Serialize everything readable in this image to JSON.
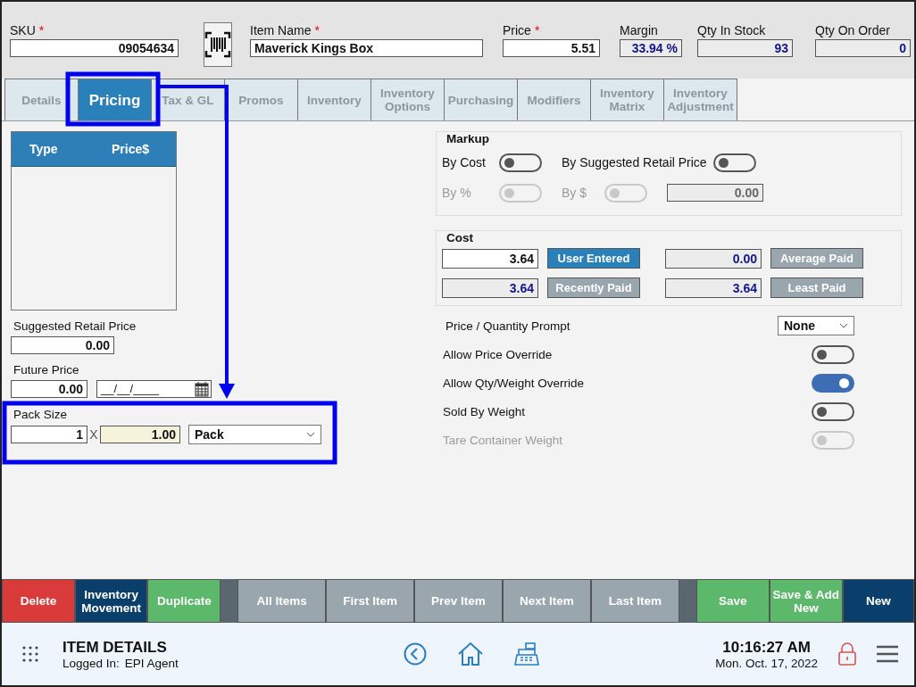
{
  "header": {
    "fields": [
      {
        "kind": "sku",
        "label": "SKU",
        "required_mark": "*",
        "value": "09054634",
        "readonly": false
      },
      {
        "kind": "name",
        "label": "Item Name",
        "required_mark": "*",
        "value": "Maverick Kings Box",
        "readonly": false
      },
      {
        "kind": "price",
        "label": "Price",
        "required_mark": "*",
        "value": "5.51",
        "readonly": false
      },
      {
        "kind": "margin",
        "label": "Margin",
        "value": "33.94 %",
        "readonly": true
      },
      {
        "kind": "stock",
        "label": "Qty In Stock",
        "value": "93",
        "readonly": true
      },
      {
        "kind": "order",
        "label": "Qty On Order",
        "value": "0",
        "readonly": true
      }
    ]
  },
  "tabs": [
    {
      "label": "Details",
      "selected": false
    },
    {
      "label": "Pricing",
      "selected": true
    },
    {
      "label": "Tax & GL",
      "selected": false
    },
    {
      "label": "Promos",
      "selected": false
    },
    {
      "label": "Inventory",
      "selected": false
    },
    {
      "label": "Inventory Options",
      "selected": false
    },
    {
      "label": "Purchasing",
      "selected": false
    },
    {
      "label": "Modifiers",
      "selected": false
    },
    {
      "label": "Inventory Matrix",
      "selected": false
    },
    {
      "label": "Inventory Adjustment",
      "selected": false
    }
  ],
  "price_table": {
    "columns": [
      "Type",
      "Price$"
    ]
  },
  "suggested_retail_price": {
    "label": "Suggested Retail Price",
    "value": "0.00"
  },
  "future_price": {
    "label": "Future Price",
    "value": "0.00",
    "date": "__/__/____"
  },
  "pack_size": {
    "label": "Pack Size",
    "quantity": "1",
    "separator": "X",
    "units": "1.00",
    "unit_type": "Pack"
  },
  "markup": {
    "title": "Markup",
    "toggles": [
      {
        "label": "By Cost",
        "on": false,
        "disabled": false
      },
      {
        "label": "By Suggested Retail Price",
        "on": false,
        "disabled": false
      },
      {
        "label": "By %",
        "on": false,
        "disabled": true
      },
      {
        "label": "By $",
        "on": false,
        "disabled": true
      }
    ],
    "amount": "0.00"
  },
  "cost": {
    "title": "Cost",
    "options": [
      {
        "value": "3.64",
        "label": "User Entered",
        "selected": true,
        "readonly": false
      },
      {
        "value": "0.00",
        "label": "Average Paid",
        "selected": false,
        "readonly": true
      },
      {
        "value": "3.64",
        "label": "Recently Paid",
        "selected": false,
        "readonly": true
      },
      {
        "value": "3.64",
        "label": "Least Paid",
        "selected": false,
        "readonly": true
      }
    ]
  },
  "prompt": {
    "label": "Price / Quantity Prompt",
    "value": "None"
  },
  "options": [
    {
      "label": "Allow Price Override",
      "on": false,
      "disabled": false
    },
    {
      "label": "Allow Qty/Weight Override",
      "on": true,
      "disabled": false
    },
    {
      "label": "Sold By Weight",
      "on": false,
      "disabled": false
    },
    {
      "label": "Tare Container Weight",
      "on": false,
      "disabled": true
    }
  ],
  "actions": [
    {
      "label": "Delete",
      "kind": "danger"
    },
    {
      "label": "Inventory Movement",
      "kind": "dark"
    },
    {
      "label": "Duplicate",
      "kind": "success"
    },
    {
      "kind": "spacer"
    },
    {
      "label": "All Items",
      "kind": "nav"
    },
    {
      "label": "First Item",
      "kind": "nav"
    },
    {
      "label": "Prev Item",
      "kind": "nav"
    },
    {
      "label": "Next Item",
      "kind": "nav"
    },
    {
      "label": "Last Item",
      "kind": "nav"
    },
    {
      "kind": "spacer"
    },
    {
      "label": "Save",
      "kind": "success"
    },
    {
      "label": "Save & Add New",
      "kind": "success"
    },
    {
      "label": "New",
      "kind": "dark"
    }
  ],
  "footer": {
    "title": "ITEM DETAILS",
    "logged_label": "Logged In:",
    "user": "EPI Agent",
    "time": "10:16:27 AM",
    "date": "Mon. Oct. 17, 2022"
  }
}
